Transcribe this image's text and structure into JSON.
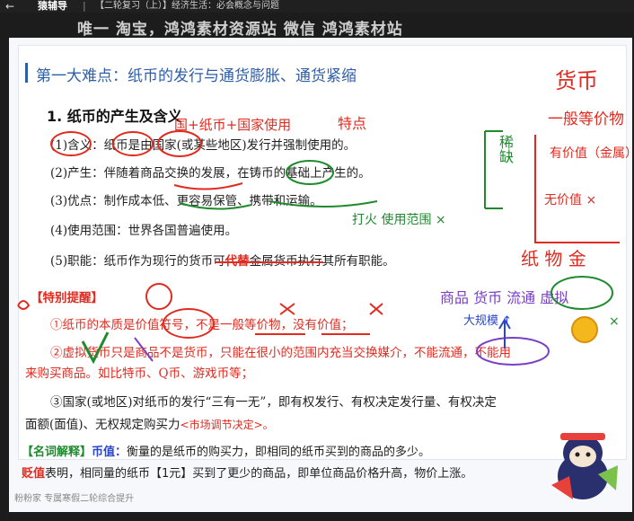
{
  "topbar": {
    "back_icon": "left-arrow-icon",
    "app_name": "猿辅导",
    "breadcrumb": "【二轮复习（上）】经济生活：必会概念与问题"
  },
  "watermark": "唯一  淘宝，鸿鸿素材资源站   微信 鸿鸿素材站",
  "slide": {
    "heading": "第一大难点：纸币的发行与通货膨胀、通货紧缩",
    "section_title": "1. 纸币的产生及含义",
    "points": [
      "(1)含义：纸币是由国家(或某些地区)发行并强制使用的。",
      "(2)产生：伴随着商品交换的发展，在铸币的基础上产生的。",
      "(3)优点：制作成本低、更容易保管、携带和运输。",
      "(4)使用范围：世界各国普遍使用。"
    ],
    "point5_prefix": "(5)职能：纸币作为现行的货币可",
    "point5_highlight": "代替",
    "point5_suffix": "金属货币执行其所有职能。",
    "tips_label": "【特别提醒】",
    "tip1": "①纸币的本质是价值符号，不是一般等价物，没有价值；",
    "tip2_line1": "②虚拟货币只是商品不是货币，只能在很小的范围内充当交换媒介，不能流通，不能用",
    "tip2_line2": "来购买商品。如比特币、Q币、游戏币等；",
    "tip3_line1": "③国家(或地区)对纸币的发行“三有一无”，即有权发行、有权决定发行量、有权决定",
    "tip3_line2": "面额(面值)、无权规定购买力",
    "tip3_note": "<市场调节决定>。",
    "term_label": "【名词解释】",
    "term_word": "币值：",
    "term_def": "衡量的是纸币的购买力，即相同的纸币买到的商品的多少。",
    "depr_word": "贬值",
    "depr_def": "表明，相同量的纸币【1元】买到了更少的商品，即单位商品价格升高，物价上涨。",
    "footer": "粉粉家 专属寒假二轮综合提升"
  },
  "annotations": {
    "a1": "货币",
    "a2": "一般等价物",
    "a3": "有价值（金属）",
    "a4": "无价值 ×",
    "a5": "纸  物  金",
    "a6": "稀缺",
    "a7": "打火 使用范围 ×",
    "a8": "国+纸币+国家使用",
    "a9": "特点",
    "a10": "商品 货币 流通 虚拟",
    "a11": "大规模 ↑"
  },
  "colors": {
    "heading_blue": "#2f5ea8",
    "ink_red": "#e02b20",
    "ink_green": "#1f8a2e",
    "ink_blue": "#2a46c8",
    "ink_purple": "#7a3fc4",
    "ink_orange": "#f07a1a"
  },
  "mascot_icon": "cartoon-mascot-icon",
  "coin_icon": "gold-coin-icon"
}
